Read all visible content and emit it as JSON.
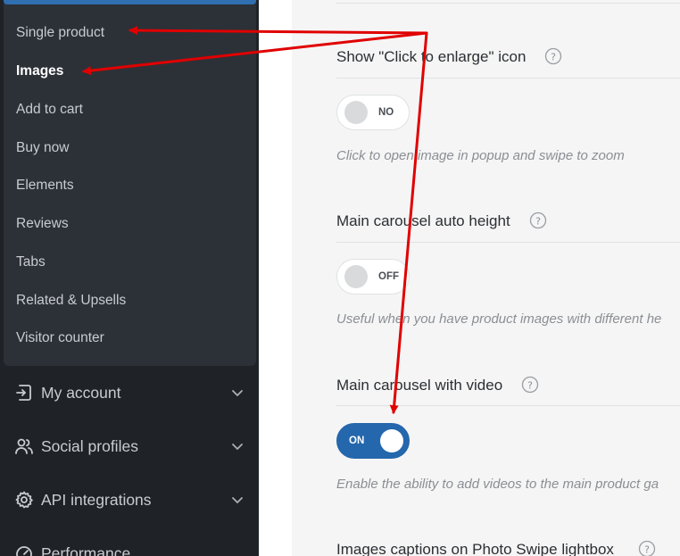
{
  "sidebar": {
    "submenu_items": [
      {
        "label": "Single product",
        "active": false
      },
      {
        "label": "Images",
        "active": true
      },
      {
        "label": "Add to cart",
        "active": false
      },
      {
        "label": "Buy now",
        "active": false
      },
      {
        "label": "Elements",
        "active": false
      },
      {
        "label": "Reviews",
        "active": false
      },
      {
        "label": "Tabs",
        "active": false
      },
      {
        "label": "Related & Upsells",
        "active": false
      },
      {
        "label": "Visitor counter",
        "active": false
      }
    ],
    "menu_items": [
      {
        "label": "My account",
        "icon": "sign-in-icon"
      },
      {
        "label": "Social profiles",
        "icon": "users-icon"
      },
      {
        "label": "API integrations",
        "icon": "gear-icon"
      },
      {
        "label": "Performance",
        "icon": "gauge-icon"
      }
    ]
  },
  "settings": [
    {
      "title": "Show \"Click to enlarge\" icon",
      "toggle": "NO",
      "enabled": false,
      "hint": "Click to open image in popup and swipe to zoom"
    },
    {
      "title": "Main carousel auto height",
      "toggle": "OFF",
      "enabled": false,
      "hint": "Useful when you have product images with different he"
    },
    {
      "title": "Main carousel with video",
      "toggle": "ON",
      "enabled": true,
      "hint": "Enable the ability to add videos to the main product ga"
    },
    {
      "title": "Images captions on Photo Swipe lightbox"
    }
  ],
  "colors": {
    "sidebar_bg": "#1f2327",
    "submenu_bg": "#2c3137",
    "accent": "#2467ad",
    "annotation_arrow": "#e00000"
  }
}
